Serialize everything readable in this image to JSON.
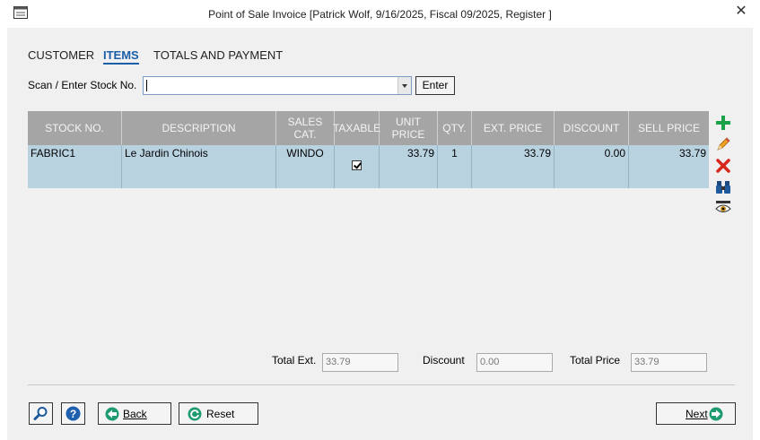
{
  "window": {
    "title": "Point of Sale Invoice [Patrick Wolf, 9/16/2025, Fiscal 09/2025, Register ]",
    "close_glyph": "✕"
  },
  "tabs": [
    {
      "label": "CUSTOMER",
      "active": false
    },
    {
      "label": "ITEMS",
      "active": true
    },
    {
      "label": "TOTALS AND PAYMENT",
      "active": false
    }
  ],
  "scan": {
    "label": "Scan / Enter Stock No.",
    "value": "",
    "enter_label": "Enter"
  },
  "grid": {
    "columns": [
      "STOCK NO.",
      "DESCRIPTION",
      "SALES CAT.",
      "TAXABLE",
      "UNIT PRICE",
      "QTY.",
      "EXT. PRICE",
      "DISCOUNT",
      "SELL PRICE"
    ],
    "rows": [
      {
        "stock_no": "FABRIC1",
        "description": "Le Jardin Chinois",
        "sales_cat": "WINDO",
        "taxable": true,
        "unit_price": "33.79",
        "qty": "1",
        "ext_price": "33.79",
        "discount": "0.00",
        "sell_price": "33.79"
      }
    ]
  },
  "tools": [
    "add-icon",
    "edit-pencil-icon",
    "delete-icon",
    "binoculars-icon",
    "view-eye-icon"
  ],
  "totals": {
    "total_ext_label": "Total Ext.",
    "total_ext_value": "33.79",
    "discount_label": "Discount",
    "discount_value": "0.00",
    "total_price_label": "Total Price",
    "total_price_value": "33.79"
  },
  "buttons": {
    "back_label": "Back",
    "reset_label": "Reset",
    "next_label": "Next"
  },
  "colors": {
    "header_bg": "#a5a5a5",
    "row_bg": "#b9d2e0",
    "accent": "#1a5fa8",
    "add": "#1aa14a",
    "delete": "#d8261c"
  }
}
